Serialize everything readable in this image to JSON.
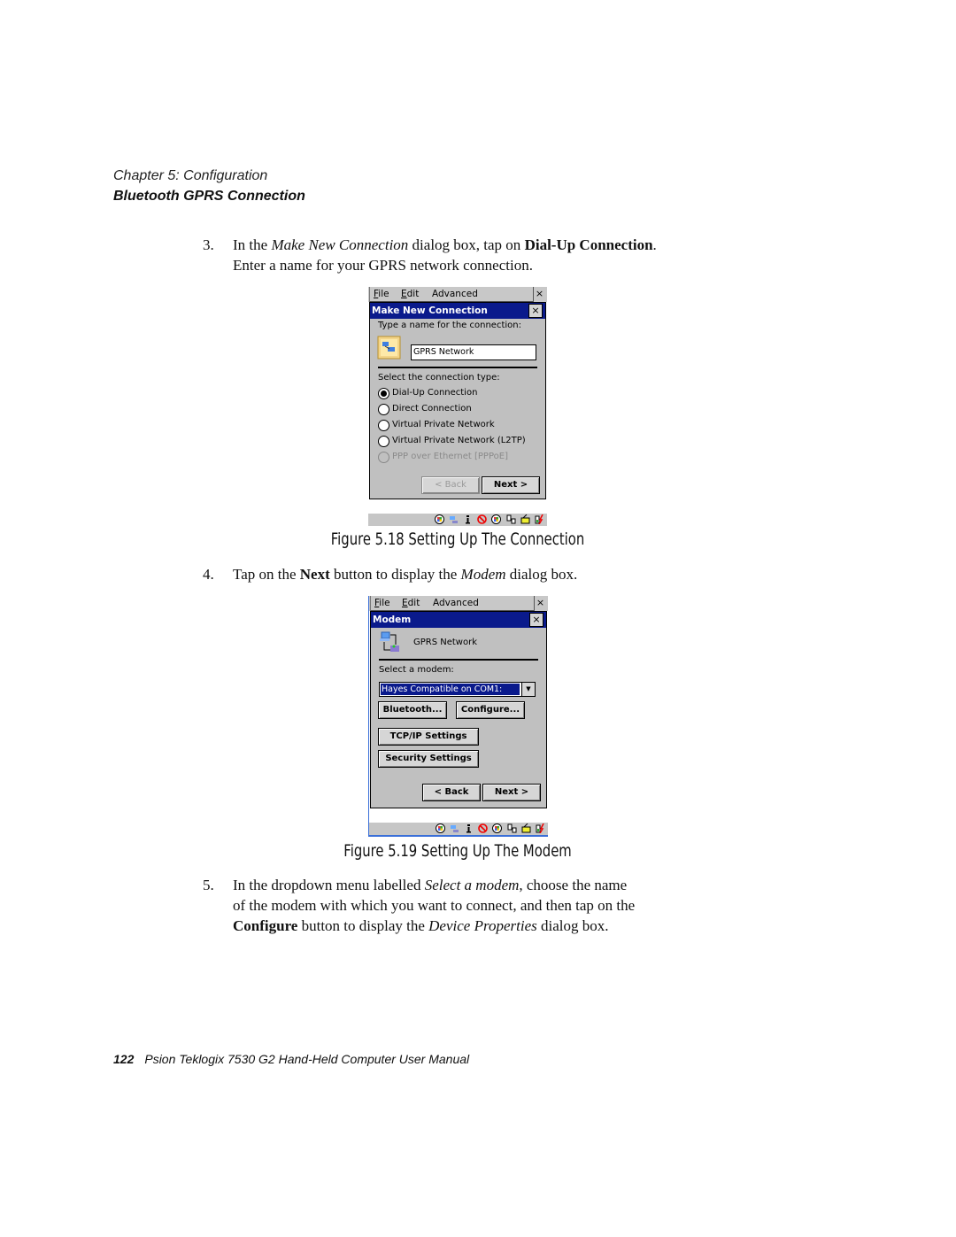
{
  "header": {
    "chapter": "Chapter  5:  Configuration",
    "section": "Bluetooth GPRS Connection"
  },
  "steps": [
    {
      "number": "3.",
      "parts": {
        "a": "In the ",
        "b_italic": "Make New Connection",
        "c": " dialog box, tap on ",
        "d_bold": "Dial-Up Connection",
        "e": ".",
        "line2": "Enter a name for your GPRS network connection."
      }
    },
    {
      "number": "4.",
      "parts": {
        "a": "Tap on the ",
        "b_bold": "Next",
        "c": " button to display the ",
        "d_italic": "Modem",
        "e": " dialog box."
      }
    },
    {
      "number": "5.",
      "parts": {
        "a": "In the dropdown menu labelled ",
        "b_italic": "Select a modem",
        "c": ", choose the name",
        "line2": "of the modem with which you want to connect, and then tap on the",
        "d_bold": "Configure",
        "e": " button to display the ",
        "f_italic": "Device Properties",
        "g": " dialog box."
      }
    }
  ],
  "figures": [
    {
      "caption": "Figure 5.18 Setting Up The Connection",
      "menu": [
        "File",
        "Edit",
        "Advanced"
      ],
      "menu_close": "×",
      "dialog_title": "Make New Connection",
      "dialog_close": "×",
      "name_label": "Type a name for the connection:",
      "name_value": "GPRS Network",
      "type_label": "Select the connection type:",
      "options": [
        {
          "label": "Dial-Up Connection",
          "selected": true,
          "enabled": true
        },
        {
          "label": "Direct Connection",
          "selected": false,
          "enabled": true
        },
        {
          "label": "Virtual Private Network",
          "selected": false,
          "enabled": true
        },
        {
          "label": "Virtual Private Network (L2TP)",
          "selected": false,
          "enabled": true
        },
        {
          "label": "PPP over Ethernet [PPPoE]",
          "selected": false,
          "enabled": false
        }
      ],
      "back_label": "< Back",
      "next_label": "Next >",
      "back_enabled": false
    },
    {
      "caption": "Figure 5.19 Setting Up The Modem",
      "menu": [
        "File",
        "Edit",
        "Advanced"
      ],
      "menu_close": "×",
      "dialog_title": "Modem",
      "dialog_close": "×",
      "connection_name": "GPRS Network",
      "modem_label": "Select a modem:",
      "modem_value": "Hayes Compatible on COM1:",
      "bluetooth_label": "Bluetooth...",
      "configure_label": "Configure...",
      "tcpip_label": "TCP/IP Settings",
      "security_label": "Security Settings",
      "back_label": "< Back",
      "next_label": "Next >"
    }
  ],
  "tray_icons": [
    "windows-logo-icon",
    "network-icon",
    "info-icon",
    "no-signal-icon",
    "windows-logo-icon",
    "connection-icon",
    "radio-icon",
    "battery-charging-icon"
  ],
  "footer": {
    "page_number": "122",
    "title": "Psion Teklogix 7530 G2 Hand-Held Computer User Manual"
  }
}
